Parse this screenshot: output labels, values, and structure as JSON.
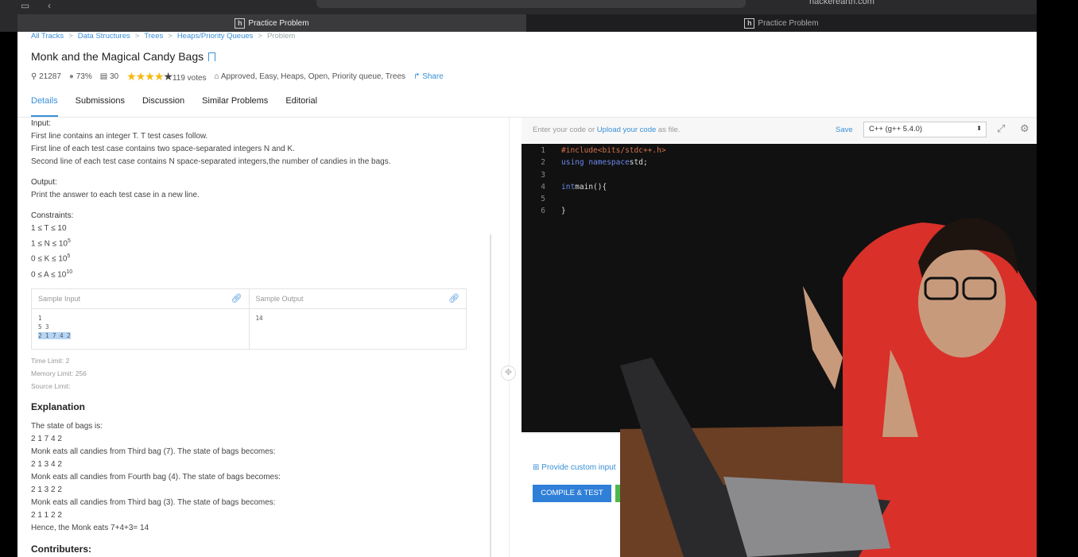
{
  "browser": {
    "url": "hackerearth.com",
    "tabs": [
      {
        "label": "Practice Problem",
        "icon": "hackerearth-h-icon"
      },
      {
        "label": "Practice Problem",
        "icon": "hackerearth-h-icon"
      }
    ]
  },
  "breadcrumbs": [
    "All Tracks",
    "Data Structures",
    "Trees",
    "Heaps/Priority Queues",
    "Problem"
  ],
  "problem": {
    "title": "Monk and the Magical Candy Bags",
    "stats": {
      "attempts": "21287",
      "success": "73%",
      "submissions": "30",
      "rating": 4,
      "votes": "119 votes",
      "tags": "Approved, Easy, Heaps, Open, Priority queue, Trees",
      "share": "Share"
    }
  },
  "tabs": [
    "Details",
    "Submissions",
    "Discussion",
    "Similar Problems",
    "Editorial"
  ],
  "details": {
    "input_heading": "Input:",
    "input_lines": [
      "First line contains an integer T. T test cases follow.",
      "First line of each test case contains two space-separated integers N and K.",
      "Second line of each test case contains N space-separated integers,the number of candies in the bags."
    ],
    "output_heading": "Output:",
    "output_line": "Print the answer to each test case in a new line.",
    "constraints_heading": "Constraints:",
    "constraints": [
      "1 ≤ T ≤ 10",
      "1 ≤ N ≤ 10",
      "0 ≤ K ≤ 10",
      "0 ≤ A ≤ 10"
    ],
    "constraint_exponents": [
      "",
      "5",
      "5",
      "10"
    ],
    "sample_input_label": "Sample Input",
    "sample_output_label": "Sample Output",
    "sample_input_lines": [
      "1",
      "5 3"
    ],
    "sample_input_selected": "2 1 7 4 2",
    "sample_output": "14",
    "time_limit": "Time Limit: 2",
    "memory_limit": "Memory Limit: 256",
    "source_limit": "Source Limit:",
    "explanation_heading": "Explanation",
    "explanation_lines": [
      "The state of bags is:",
      "2 1 7 4 2",
      "Monk eats all candies from Third bag (7). The state of bags becomes:",
      "2 1 3 4 2",
      "Monk eats all candies from Fourth bag (4). The state of bags becomes:",
      "2 1 3 2 2",
      "Monk eats all candies from Third bag (3). The state of bags becomes:",
      "2 1 1 2 2",
      "Hence, the Monk eats 7+4+3= 14"
    ],
    "contributers_heading": "Contributers:"
  },
  "editor": {
    "hint_prefix": "Enter your code or ",
    "hint_link": "Upload your code",
    "hint_suffix": " as file.",
    "save": "Save",
    "language": "C++ (g++ 5.4.0)",
    "code_lines": [
      {
        "n": "1",
        "kw": "#include ",
        "rest": "<bits/stdc++.h>"
      },
      {
        "n": "2",
        "kw": "using namespace ",
        "rest": "std;"
      },
      {
        "n": "3",
        "kw": "",
        "rest": ""
      },
      {
        "n": "4",
        "kw": "int ",
        "rest": "main(){"
      },
      {
        "n": "5",
        "kw": "",
        "rest": ""
      },
      {
        "n": "6",
        "kw": "",
        "rest": "}"
      }
    ],
    "custom_input": "Provide custom input",
    "compile_button": "COMPILE & TEST"
  }
}
